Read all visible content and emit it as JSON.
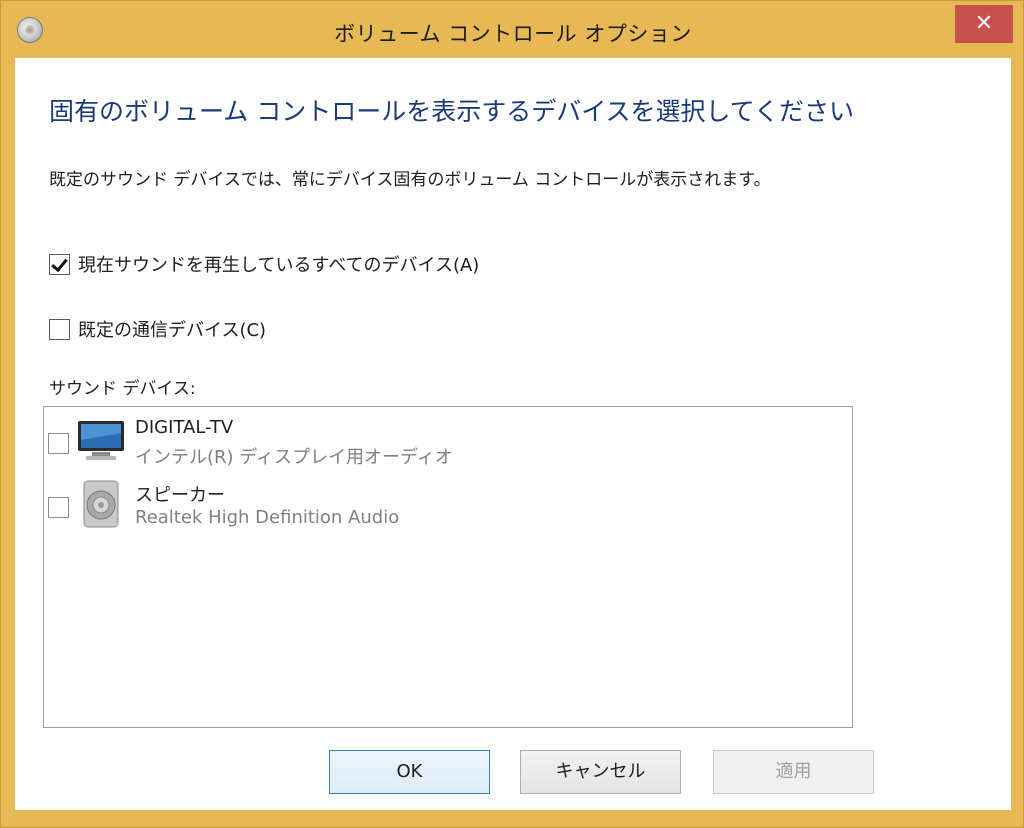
{
  "window": {
    "title": "ボリューム コントロール オプション",
    "close_glyph": "✕"
  },
  "heading": "固有のボリューム コントロールを表示するデバイスを選択してください",
  "description": "既定のサウンド デバイスでは、常にデバイス固有のボリューム コントロールが表示されます。",
  "options": {
    "all_playing": {
      "label": "現在サウンドを再生しているすべてのデバイス(A)",
      "checked": true
    },
    "comm_device": {
      "label": "既定の通信デバイス(C)",
      "checked": false
    }
  },
  "sound_devices_label": "サウンド デバイス:",
  "devices": [
    {
      "name": "DIGITAL-TV",
      "description": "インテル(R) ディスプレイ用オーディオ",
      "icon": "tv-monitor-icon",
      "checked": false
    },
    {
      "name": "スピーカー",
      "description": "Realtek High Definition Audio",
      "icon": "speaker-icon",
      "checked": false
    }
  ],
  "buttons": {
    "ok": "OK",
    "cancel": "キャンセル",
    "apply": "適用"
  },
  "colors": {
    "frame": "#e6b955",
    "close": "#c7504a",
    "heading": "#1b3a7a"
  }
}
